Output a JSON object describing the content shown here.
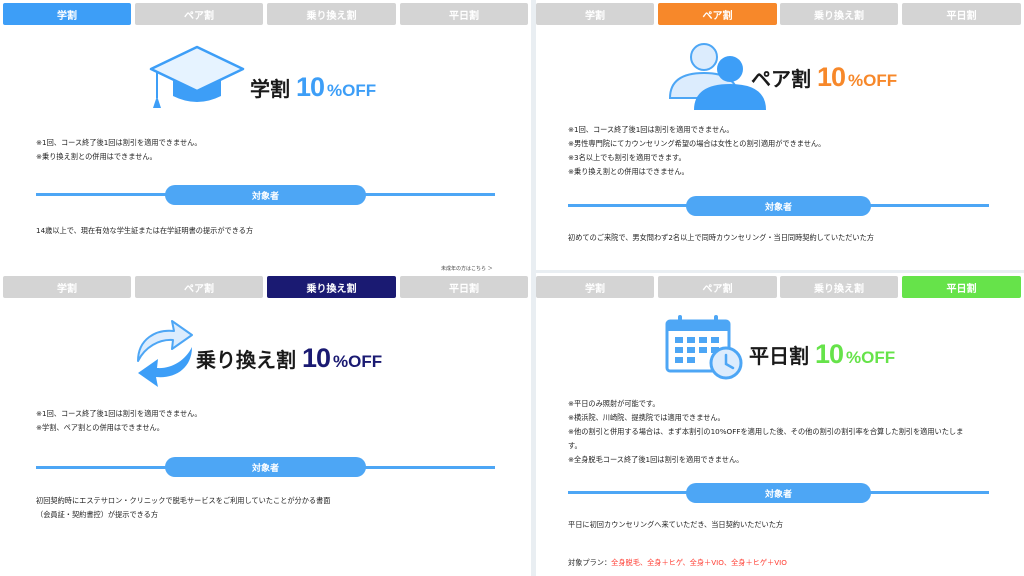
{
  "tabs": {
    "student": "学割",
    "pair": "ペア割",
    "transfer": "乗り換え割",
    "weekday": "平日割"
  },
  "colors": {
    "student_active": "#3d9ef7",
    "pair_active": "#f7882a",
    "transfer_active": "#1a1a72",
    "weekday_active": "#66e34a",
    "inactive_tab": "#d4d4d4",
    "section_line": "#4da6f5"
  },
  "discount": {
    "number": "10",
    "unit": "%OFF"
  },
  "target_label": "対象者",
  "student": {
    "icon": "graduation-cap-icon",
    "title": "学割",
    "notes": [
      "※1回、コース終了後1回は割引を適用できません。",
      "※乗り換え割との併用はできません。"
    ],
    "target": "14歳以上で、現在有効な学生証または在学証明書の提示ができる方",
    "minor_link": "未成年の方はこちら ＞"
  },
  "pair": {
    "icon": "people-icon",
    "title": "ペア割",
    "notes": [
      "※1回、コース終了後1回は割引を適用できません。",
      "※男性専門院にてカウンセリング希望の場合は女性との割引適用ができません。",
      "※3名以上でも割引を適用できます。",
      "※乗り換え割との併用はできません。"
    ],
    "target": "初めてのご来院で、男女問わず2名以上で同時カウンセリング・当日同時契約していただいた方"
  },
  "transfer": {
    "icon": "switch-arrows-icon",
    "title": "乗り換え割",
    "notes": [
      "※1回、コース終了後1回は割引を適用できません。",
      "※学割、ペア割との併用はできません。"
    ],
    "target": [
      "初回契約時にエステサロン・クリニックで脱毛サービスをご利用していたことが分かる書面",
      "（会員証・契約書控）が提示できる方"
    ]
  },
  "weekday": {
    "icon": "calendar-clock-icon",
    "title": "平日割",
    "notes": [
      "※平日のみ照射が可能です。",
      "※横浜院、川崎院、提携院では適用できません。",
      "※他の割引と併用する場合は、まず本割引の10%OFFを適用した後、その他の割引の割引率を合算した割引を適用いたしま",
      "す。",
      "※全身脱毛コース終了後1回は割引を適用できません。"
    ],
    "target": "平日に初回カウンセリングへ来ていただき、当日契約いただいた方",
    "plan_label": "対象プラン：",
    "plan_value": "全身脱毛、全身＋ヒゲ、全身＋VIO、全身＋ヒゲ＋VIO"
  }
}
